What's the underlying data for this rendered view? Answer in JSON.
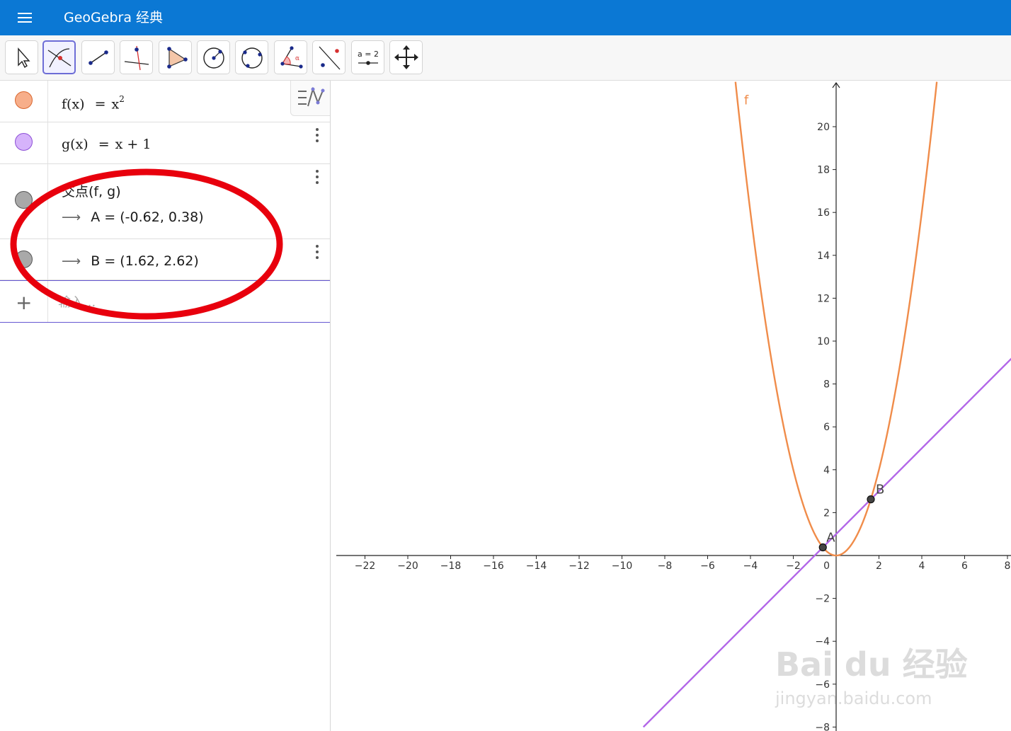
{
  "titlebar": {
    "title": "GeoGebra 经典",
    "menu_icon": "hamburger-menu-icon",
    "color": "#0b78d4"
  },
  "toolbar": {
    "tools": [
      {
        "name": "move-tool",
        "icon": "cursor-arrow-icon"
      },
      {
        "name": "intersect-tool",
        "icon": "intersect-icon",
        "active": true
      },
      {
        "name": "segment-tool",
        "icon": "segment-icon"
      },
      {
        "name": "perpendicular-line-tool",
        "icon": "perpendicular-line-icon"
      },
      {
        "name": "polygon-tool",
        "icon": "polygon-icon"
      },
      {
        "name": "circle-tool",
        "icon": "circle-center-point-icon"
      },
      {
        "name": "circle-through-3-points-tool",
        "icon": "circle-three-points-icon"
      },
      {
        "name": "angle-tool",
        "icon": "angle-icon"
      },
      {
        "name": "reflect-tool",
        "icon": "reflect-about-line-icon"
      },
      {
        "name": "slider-tool",
        "icon": "slider-icon",
        "label": "a = 2"
      },
      {
        "name": "move-graphics-view-tool",
        "icon": "move-graphics-view-icon"
      }
    ]
  },
  "algebra": {
    "f": {
      "lhs": "f(x)",
      "eq": "=",
      "rhs_base": "x",
      "rhs_exp": "2",
      "color": "#f4a57f"
    },
    "g": {
      "lhs": "g(x)",
      "eq": "=",
      "rhs": "x + 1",
      "color": "#c8a8f5"
    },
    "intersect": {
      "command": "交点(f, g)",
      "color": "#a8a8a8",
      "a": {
        "arrow": "⟶",
        "text": "A = (-0.62, 0.38)"
      },
      "b": {
        "arrow": "⟶",
        "text": "B = (1.62, 2.62)"
      }
    },
    "input": {
      "plus": "+",
      "placeholder": "输入..."
    }
  },
  "graphics": {
    "x_ticks": [
      "−22",
      "−20",
      "−18",
      "−16",
      "−14",
      "−12",
      "−10",
      "−8",
      "−6",
      "−4",
      "−2",
      "2",
      "4",
      "6",
      "8"
    ],
    "y_ticks": [
      "20",
      "18",
      "16",
      "14",
      "12",
      "10",
      "8",
      "6",
      "4",
      "2",
      "−2",
      "−4",
      "−6",
      "−8"
    ],
    "origin_label": "0",
    "curve_f_label": "f",
    "point_a": {
      "label": "A",
      "x": -0.62,
      "y": 0.38
    },
    "point_b": {
      "label": "B",
      "x": 1.62,
      "y": 2.62
    },
    "f_color": "#f08c4a",
    "g_color": "#b266e8",
    "annotation_color": "#e8000d"
  }
}
